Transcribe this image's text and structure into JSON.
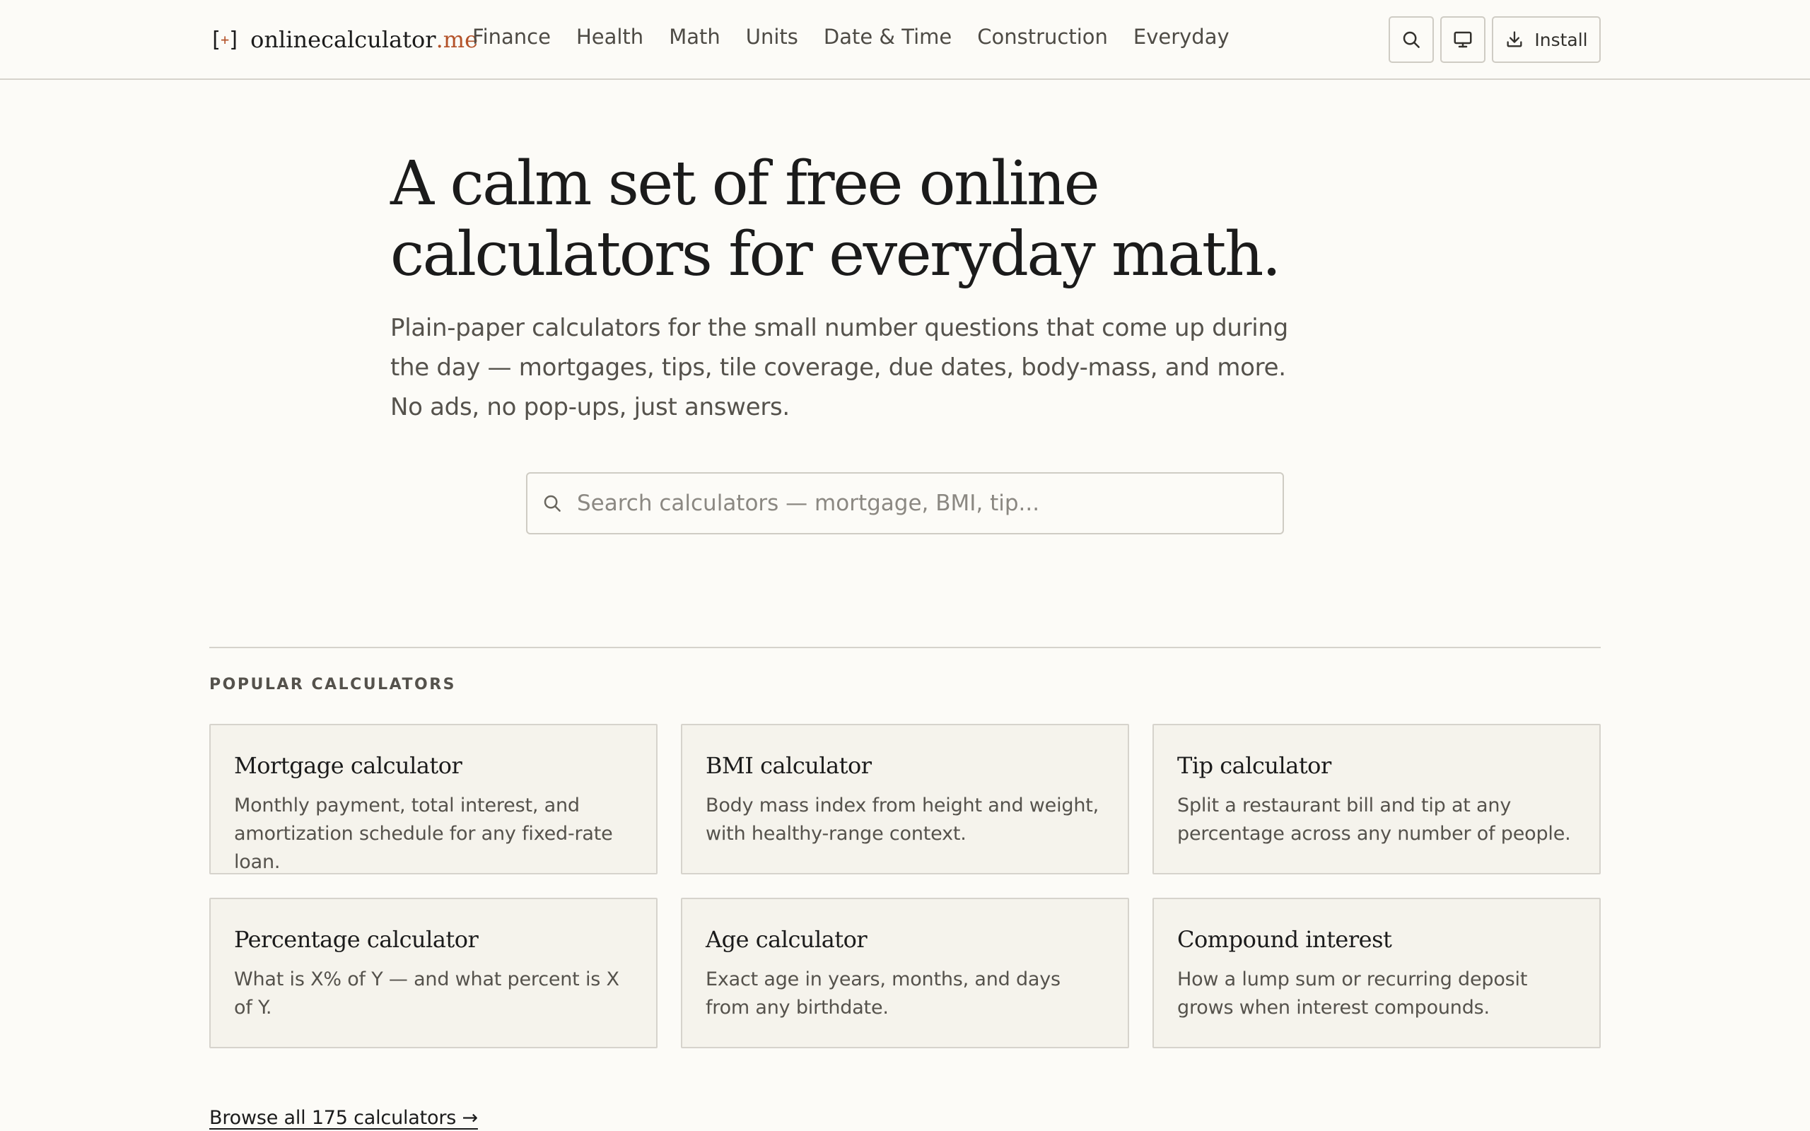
{
  "header": {
    "logo": {
      "mark_open": "[",
      "mark_plus": "+",
      "mark_close": "]",
      "name": "onlinecalculator",
      "tld": ".me"
    },
    "nav": [
      {
        "label": "Finance"
      },
      {
        "label": "Health"
      },
      {
        "label": "Math"
      },
      {
        "label": "Units"
      },
      {
        "label": "Date & Time"
      },
      {
        "label": "Construction"
      },
      {
        "label": "Everyday"
      }
    ],
    "tools": {
      "search_icon": "search-icon",
      "display_icon": "monitor-icon",
      "install_icon": "download-icon",
      "install_label": "Install"
    }
  },
  "hero": {
    "title": "A calm set of free online calculators for everyday math.",
    "subtitle": "Plain-paper calculators for the small number questions that come up during the day — mortgages, tips, tile coverage, due dates, body-mass, and more. No ads, no pop-ups, just answers.",
    "search_placeholder": "Search calculators — mortgage, BMI, tip..."
  },
  "popular": {
    "label": "POPULAR CALCULATORS",
    "cards": [
      {
        "title": "Mortgage calculator",
        "desc": "Monthly payment, total interest, and amortization schedule for any fixed-rate loan."
      },
      {
        "title": "BMI calculator",
        "desc": "Body mass index from height and weight, with healthy-range context."
      },
      {
        "title": "Tip calculator",
        "desc": "Split a restaurant bill and tip at any percentage across any number of people."
      },
      {
        "title": "Percentage calculator",
        "desc": "What is X% of Y — and what percent is X of Y."
      },
      {
        "title": "Age calculator",
        "desc": "Exact age in years, months, and days from any birthdate."
      },
      {
        "title": "Compound interest",
        "desc": "How a lump sum or recurring deposit grows when interest compounds."
      }
    ],
    "browse_all": "Browse all 175 calculators →"
  },
  "colors": {
    "background": "#fcfbf7",
    "card_background": "#f5f3ec",
    "accent": "#b4532a",
    "text": "#1b1b1b",
    "muted_text": "#55524c",
    "border": "#d6d3cc"
  }
}
